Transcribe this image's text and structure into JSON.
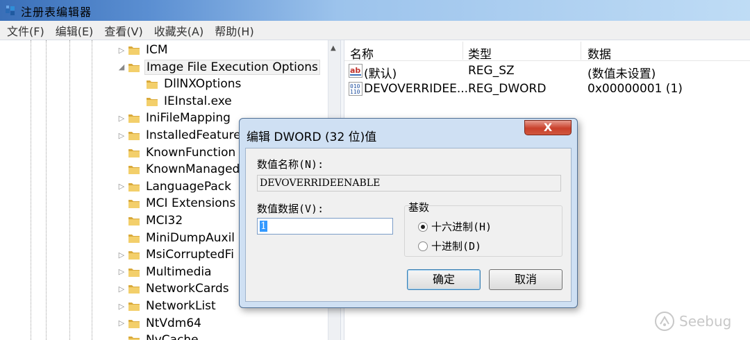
{
  "window": {
    "title": "注册表编辑器"
  },
  "menu": [
    "文件(F)",
    "编辑(E)",
    "查看(V)",
    "收藏夹(A)",
    "帮助(H)"
  ],
  "tree": [
    {
      "label": "ICM",
      "expander": "▷",
      "level": 0
    },
    {
      "label": "Image File Execution Options",
      "expander": "◢",
      "level": 0,
      "selected": true
    },
    {
      "label": "DllNXOptions",
      "expander": "",
      "level": 1
    },
    {
      "label": "IEInstal.exe",
      "expander": "",
      "level": 1
    },
    {
      "label": "IniFileMapping",
      "expander": "▷",
      "level": 0
    },
    {
      "label": "InstalledFeature",
      "expander": "▷",
      "level": 0
    },
    {
      "label": "KnownFunction",
      "expander": "",
      "level": 0
    },
    {
      "label": "KnownManaged",
      "expander": "",
      "level": 0
    },
    {
      "label": "LanguagePack",
      "expander": "▷",
      "level": 0
    },
    {
      "label": "MCI Extensions",
      "expander": "",
      "level": 0
    },
    {
      "label": "MCI32",
      "expander": "",
      "level": 0
    },
    {
      "label": "MiniDumpAuxil",
      "expander": "",
      "level": 0
    },
    {
      "label": "MsiCorruptedFi",
      "expander": "▷",
      "level": 0
    },
    {
      "label": "Multimedia",
      "expander": "▷",
      "level": 0
    },
    {
      "label": "NetworkCards",
      "expander": "▷",
      "level": 0
    },
    {
      "label": "NetworkList",
      "expander": "▷",
      "level": 0
    },
    {
      "label": "NtVdm64",
      "expander": "▷",
      "level": 0
    },
    {
      "label": "NvCache",
      "expander": "",
      "level": 0
    }
  ],
  "list": {
    "headers": {
      "name": "名称",
      "type": "类型",
      "data": "数据"
    },
    "rows": [
      {
        "icon": "string-value-icon",
        "name": "(默认)",
        "type": "REG_SZ",
        "data": "(数值未设置)"
      },
      {
        "icon": "dword-value-icon",
        "name": "DEVOVERRIDEE...",
        "type": "REG_DWORD",
        "data": "0x00000001 (1)"
      }
    ]
  },
  "dialog": {
    "title": "编辑 DWORD (32 位)值",
    "close_label": "X",
    "name_label": "数值名称(N):",
    "name_value": "DEVOVERRIDEENABLE",
    "data_label": "数值数据(V):",
    "data_value": "1",
    "base_label": "基数",
    "radio_hex": "十六进制(H)",
    "radio_dec": "十进制(D)",
    "ok_label": "确定",
    "cancel_label": "取消"
  },
  "watermark": {
    "text": "Seebug"
  },
  "colors": {
    "selection": "#3399ff",
    "dialog_frame": "#cfe0f3",
    "close_button": "#c9402b"
  }
}
